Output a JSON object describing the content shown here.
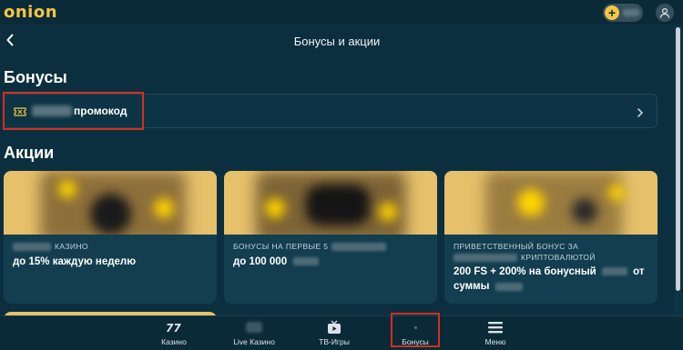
{
  "topbar": {
    "logo": "onion",
    "plus_symbol": "+",
    "icons": {
      "plus": "plus-icon",
      "user": "user-icon"
    }
  },
  "header": {
    "title": "Бонусы и акции",
    "back_icon": "chevron-left-icon"
  },
  "bonuses": {
    "section_title": "Бонусы",
    "promo_label": "промокод",
    "icons": {
      "ticket": "ticket-icon",
      "chevron": "chevron-right-icon"
    }
  },
  "promotions": {
    "section_title": "Акции",
    "cards": [
      {
        "subtitle": "КАЗИНО",
        "title": "до 15% каждую неделю"
      },
      {
        "subtitle": "БОНУСЫ НА ПЕРВЫЕ 5",
        "title": "до 100 000"
      },
      {
        "subtitle_line1": "ПРИВЕТСТВЕННЫЙ БОНУС ЗА",
        "subtitle_line2": "КРИПТОВАЛЮТОЙ",
        "title_part1": "200 FS + 200% на бонусный",
        "title_part2": "от",
        "title_part3": "суммы"
      }
    ]
  },
  "bottom_nav": {
    "items": [
      {
        "label": "Казино",
        "icon": "sevens-icon"
      },
      {
        "label": "Live Казино",
        "icon": "live-casino-icon"
      },
      {
        "label": "ТВ-Игры",
        "icon": "tv-icon"
      },
      {
        "label": "Бонусы",
        "icon": "gift-icon"
      },
      {
        "label": "Меню",
        "icon": "menu-icon"
      }
    ]
  },
  "colors": {
    "background": "#0b2f3f",
    "accent": "#f5c542",
    "highlight_border": "#d62d20",
    "card": "#123e50",
    "banner": "#e6c06a"
  }
}
